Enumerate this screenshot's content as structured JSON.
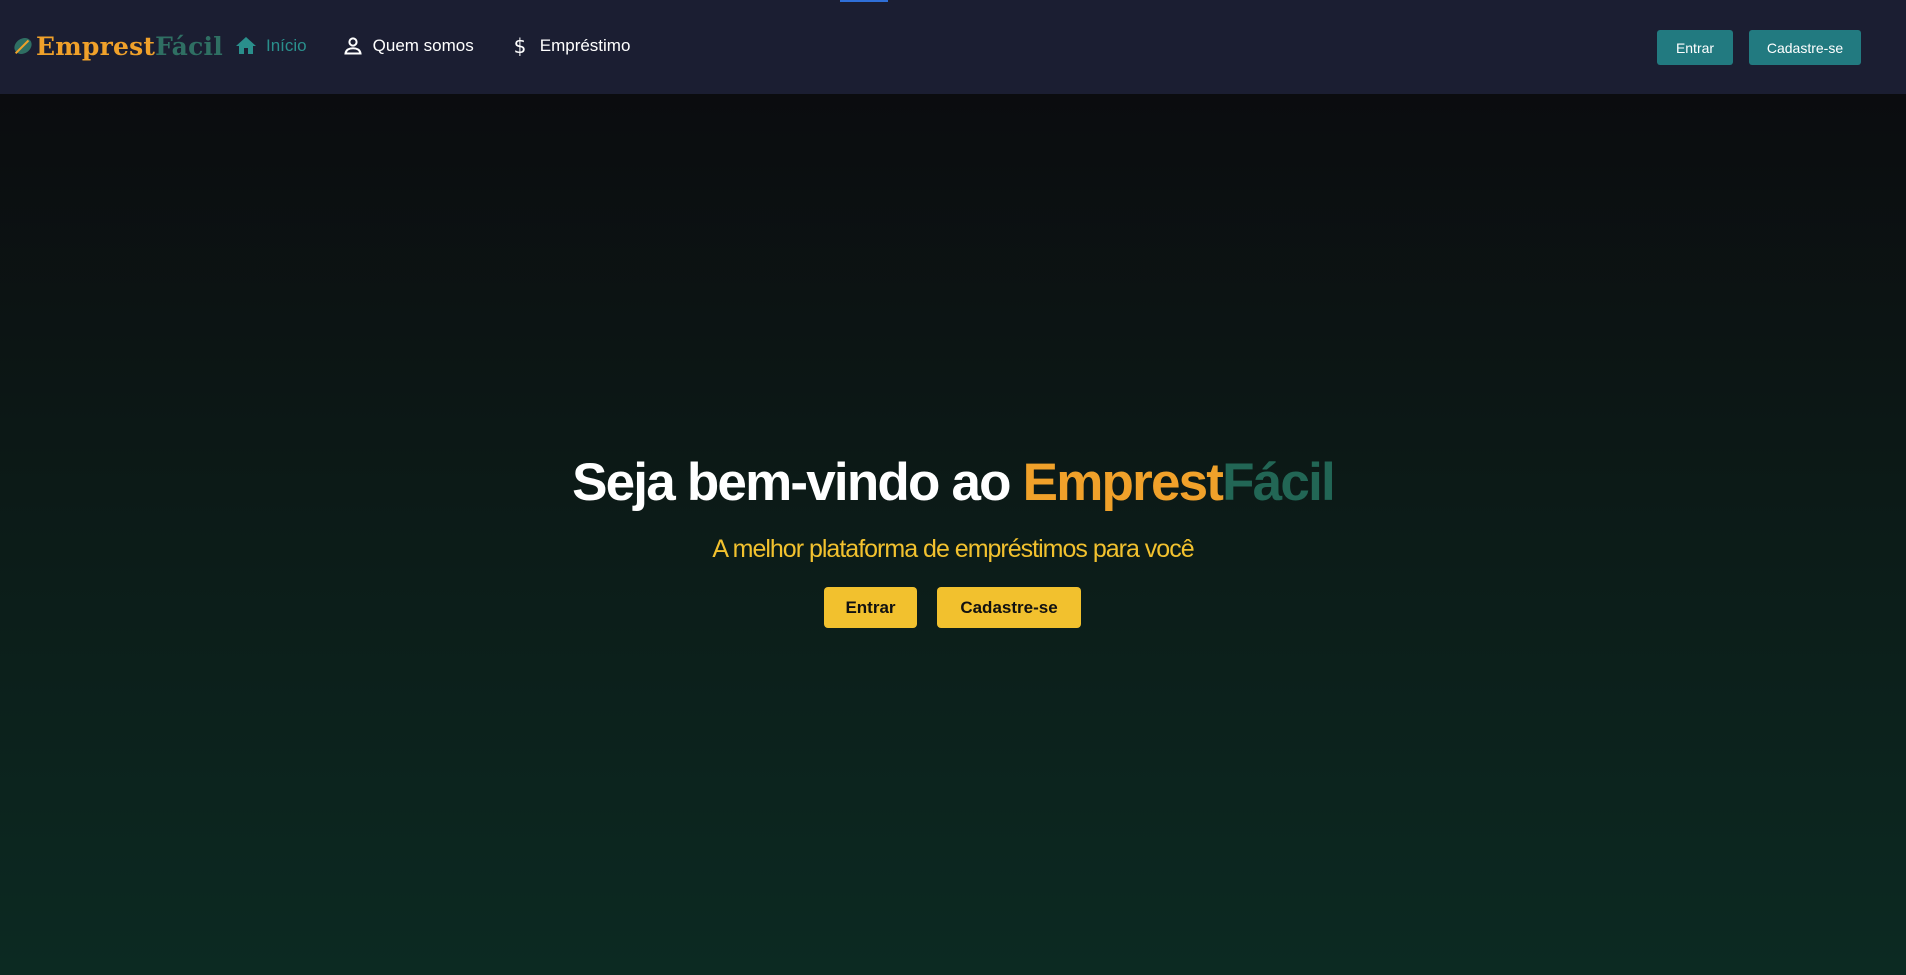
{
  "logo": {
    "part1": "Emprest",
    "part2": "Fácil"
  },
  "nav": {
    "items": [
      {
        "label": "Início",
        "icon": "home-icon",
        "active": true
      },
      {
        "label": "Quem somos",
        "icon": "person-icon",
        "active": false
      },
      {
        "label": "Empréstimo",
        "icon": "dollar-icon",
        "active": false
      }
    ],
    "login_label": "Entrar",
    "signup_label": "Cadastre-se"
  },
  "hero": {
    "title_prefix": "Seja bem-vindo ao ",
    "brand_part1": "Emprest",
    "brand_part2": "Fácil",
    "subtitle": "A melhor plataforma de empréstimos para você",
    "login_label": "Entrar",
    "signup_label": "Cadastre-se"
  },
  "colors": {
    "navbar_bg": "#1b1e32",
    "accent_teal": "#227a80",
    "brand_orange": "#f0a12a",
    "brand_green": "#226655",
    "cta_yellow": "#f2c12e"
  }
}
